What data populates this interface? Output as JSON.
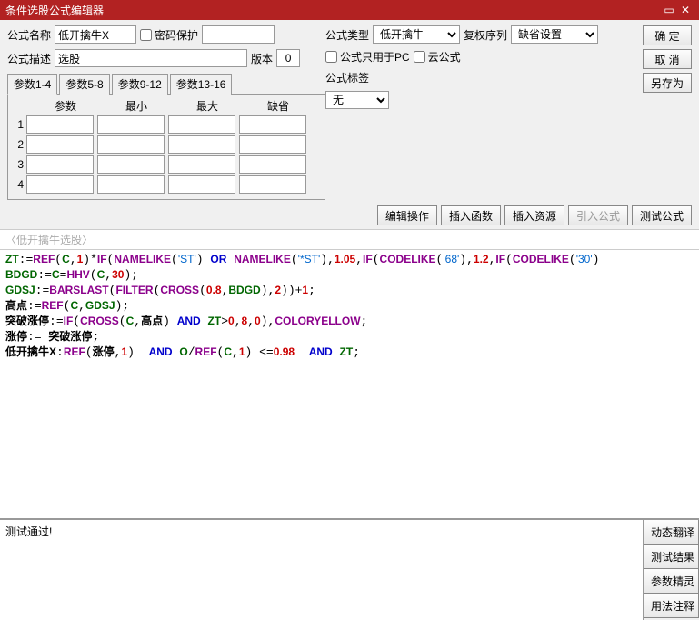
{
  "window": {
    "title": "条件选股公式编辑器"
  },
  "form": {
    "name_label": "公式名称",
    "name_value": "低开擒牛X",
    "pw_protect": "密码保护",
    "desc_label": "公式描述",
    "desc_value": "选股",
    "version_label": "版本",
    "version_value": "0",
    "type_label": "公式类型",
    "type_value": "低开擒牛",
    "adj_label": "复权序列",
    "adj_value": "缺省设置",
    "pc_only": "公式只用于PC",
    "cloud": "云公式",
    "tag_label": "公式标签",
    "tag_value": "无"
  },
  "buttons": {
    "ok": "确 定",
    "cancel": "取 消",
    "saveas": "另存为",
    "edit_op": "编辑操作",
    "ins_func": "插入函数",
    "ins_res": "插入资源",
    "import_formula": "引入公式",
    "test_formula": "测试公式"
  },
  "param_tabs": [
    "参数1-4",
    "参数5-8",
    "参数9-12",
    "参数13-16"
  ],
  "param_headers": {
    "name": "参数",
    "min": "最小",
    "max": "最大",
    "def": "缺省"
  },
  "param_rows": [
    "1",
    "2",
    "3",
    "4"
  ],
  "code_title": "〈低开擒牛选股〉",
  "status_msg": "测试通过!",
  "side_buttons": [
    "动态翻译",
    "测试结果",
    "参数精灵",
    "用法注释"
  ],
  "code_tokens": [
    [
      [
        "id",
        "ZT"
      ],
      [
        "p",
        ":="
      ],
      [
        "fn",
        "REF"
      ],
      [
        "p",
        "("
      ],
      [
        "id",
        "C"
      ],
      [
        "p",
        ","
      ],
      [
        "n",
        "1"
      ],
      [
        "p",
        ")*"
      ],
      [
        "fn",
        "IF"
      ],
      [
        "p",
        "("
      ],
      [
        "fn",
        "NAMELIKE"
      ],
      [
        "p",
        "("
      ],
      [
        "s",
        "'ST'"
      ],
      [
        "p",
        ") "
      ],
      [
        "kw",
        "OR"
      ],
      [
        "p",
        " "
      ],
      [
        "fn",
        "NAMELIKE"
      ],
      [
        "p",
        "("
      ],
      [
        "s",
        "'*ST'"
      ],
      [
        "p",
        "),"
      ],
      [
        "n",
        "1.05"
      ],
      [
        "p",
        ","
      ],
      [
        "fn",
        "IF"
      ],
      [
        "p",
        "("
      ],
      [
        "fn",
        "CODELIKE"
      ],
      [
        "p",
        "("
      ],
      [
        "s",
        "'68'"
      ],
      [
        "p",
        "),"
      ],
      [
        "n",
        "1.2"
      ],
      [
        "p",
        ","
      ],
      [
        "fn",
        "IF"
      ],
      [
        "p",
        "("
      ],
      [
        "fn",
        "CODELIKE"
      ],
      [
        "p",
        "("
      ],
      [
        "s",
        "'30'"
      ],
      [
        "p",
        ")"
      ]
    ],
    [
      [
        "id",
        "BDGD"
      ],
      [
        "p",
        ":="
      ],
      [
        "id",
        "C"
      ],
      [
        "p",
        "="
      ],
      [
        "fn",
        "HHV"
      ],
      [
        "p",
        "("
      ],
      [
        "id",
        "C"
      ],
      [
        "p",
        ","
      ],
      [
        "n",
        "30"
      ],
      [
        "p",
        ");"
      ]
    ],
    [
      [
        "id",
        "GDSJ"
      ],
      [
        "p",
        ":="
      ],
      [
        "fn",
        "BARSLAST"
      ],
      [
        "p",
        "("
      ],
      [
        "fn",
        "FILTER"
      ],
      [
        "p",
        "("
      ],
      [
        "fn",
        "CROSS"
      ],
      [
        "p",
        "("
      ],
      [
        "n",
        "0.8"
      ],
      [
        "p",
        ","
      ],
      [
        "id",
        "BDGD"
      ],
      [
        "p",
        "),"
      ],
      [
        "n",
        "2"
      ],
      [
        "p",
        "))+"
      ],
      [
        "n",
        "1"
      ],
      [
        "p",
        ";"
      ]
    ],
    [
      [
        "cn",
        "高点"
      ],
      [
        "p",
        ":="
      ],
      [
        "fn",
        "REF"
      ],
      [
        "p",
        "("
      ],
      [
        "id",
        "C"
      ],
      [
        "p",
        ","
      ],
      [
        "id",
        "GDSJ"
      ],
      [
        "p",
        ");"
      ]
    ],
    [
      [
        "cn",
        "突破涨停"
      ],
      [
        "p",
        ":="
      ],
      [
        "fn",
        "IF"
      ],
      [
        "p",
        "("
      ],
      [
        "fn",
        "CROSS"
      ],
      [
        "p",
        "("
      ],
      [
        "id",
        "C"
      ],
      [
        "p",
        ","
      ],
      [
        "cn",
        "高点"
      ],
      [
        "p",
        ") "
      ],
      [
        "kw",
        "AND"
      ],
      [
        "p",
        " "
      ],
      [
        "id",
        "ZT"
      ],
      [
        "p",
        ">"
      ],
      [
        "n",
        "0"
      ],
      [
        "p",
        ","
      ],
      [
        "n",
        "8"
      ],
      [
        "p",
        ","
      ],
      [
        "n",
        "0"
      ],
      [
        "p",
        "),"
      ],
      [
        "fn",
        "COLORYELLOW"
      ],
      [
        "p",
        ";"
      ]
    ],
    [
      [
        "cn",
        "涨停"
      ],
      [
        "p",
        ":= "
      ],
      [
        "cn",
        "突破涨停"
      ],
      [
        "p",
        ";"
      ]
    ],
    [
      [
        "cn",
        "低开擒牛X"
      ],
      [
        "p",
        ":"
      ],
      [
        "fn",
        "REF"
      ],
      [
        "p",
        "("
      ],
      [
        "cn",
        "涨停"
      ],
      [
        "p",
        ","
      ],
      [
        "n",
        "1"
      ],
      [
        "p",
        ")  "
      ],
      [
        "kw",
        "AND"
      ],
      [
        "p",
        " "
      ],
      [
        "id",
        "O"
      ],
      [
        "p",
        "/"
      ],
      [
        "fn",
        "REF"
      ],
      [
        "p",
        "("
      ],
      [
        "id",
        "C"
      ],
      [
        "p",
        ","
      ],
      [
        "n",
        "1"
      ],
      [
        "p",
        ") <="
      ],
      [
        "n",
        "0.98"
      ],
      [
        "p",
        "  "
      ],
      [
        "kw",
        "AND"
      ],
      [
        "p",
        " "
      ],
      [
        "id",
        "ZT"
      ],
      [
        "p",
        ";"
      ]
    ]
  ]
}
